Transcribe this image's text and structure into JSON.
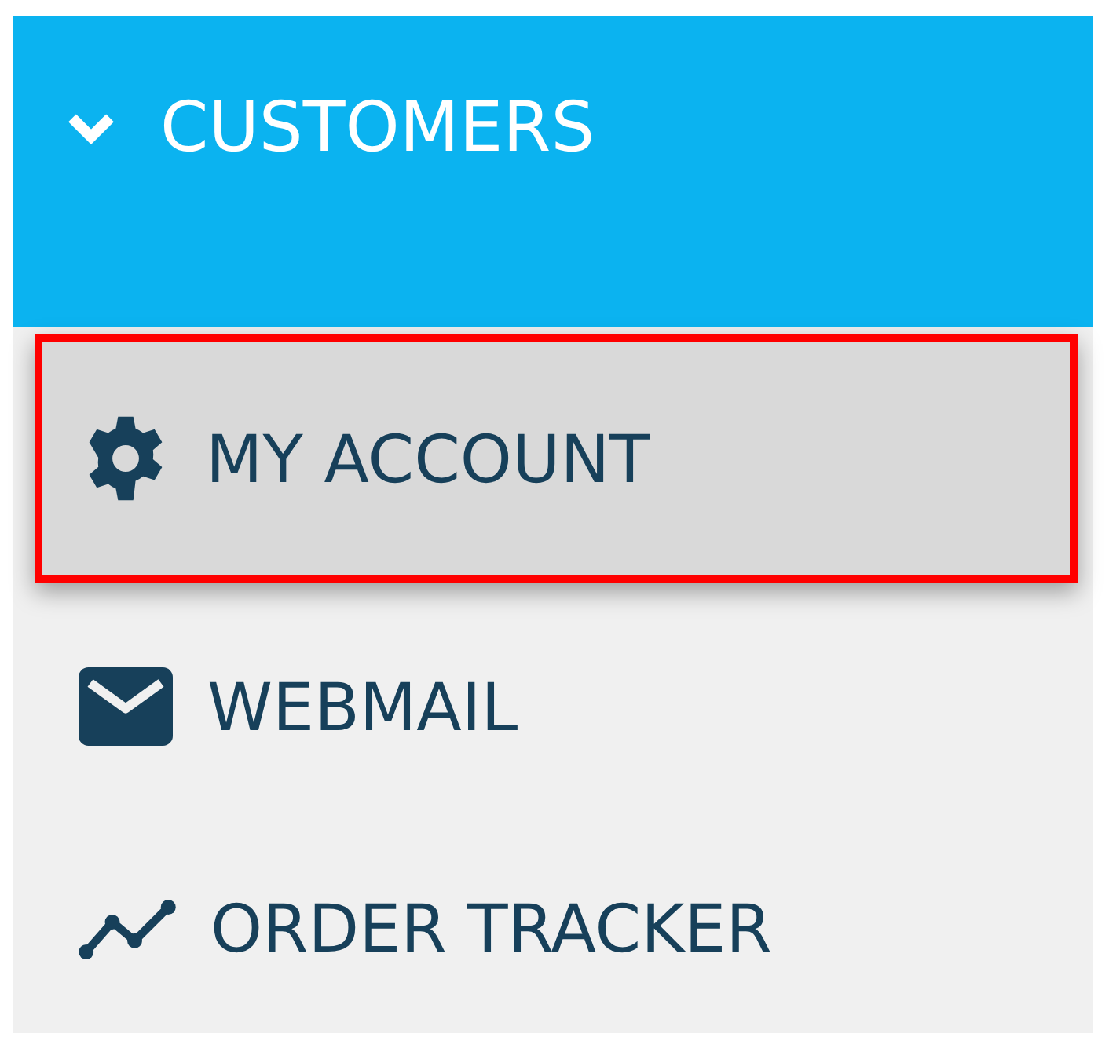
{
  "menu": {
    "title": "CUSTOMERS",
    "expanded": true
  },
  "items": [
    {
      "label": "MY ACCOUNT",
      "selected": true
    },
    {
      "label": "WEBMAIL",
      "selected": false
    },
    {
      "label": "ORDER TRACKER",
      "selected": false
    }
  ]
}
